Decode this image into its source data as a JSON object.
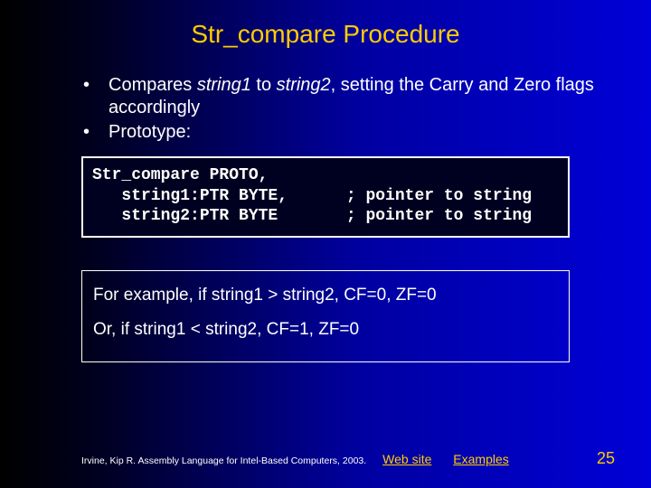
{
  "title": "Str_compare Procedure",
  "bullets": {
    "b1_pre": "Compares ",
    "b1_s1": "string1",
    "b1_mid": " to ",
    "b1_s2": "string2",
    "b1_post": ", setting the Carry and Zero flags accordingly",
    "b2": "Prototype:"
  },
  "code": "Str_compare PROTO,\n   string1:PTR BYTE,      ; pointer to string\n   string2:PTR BYTE       ; pointer to string",
  "example": {
    "line1": "For example, if string1 > string2, CF=0, ZF=0",
    "line2": "Or, if string1 < string2, CF=1, ZF=0"
  },
  "footer": {
    "citation": "Irvine, Kip R. Assembly Language for Intel-Based Computers, 2003.",
    "link_web": "Web site",
    "link_examples": "Examples",
    "page": "25"
  }
}
